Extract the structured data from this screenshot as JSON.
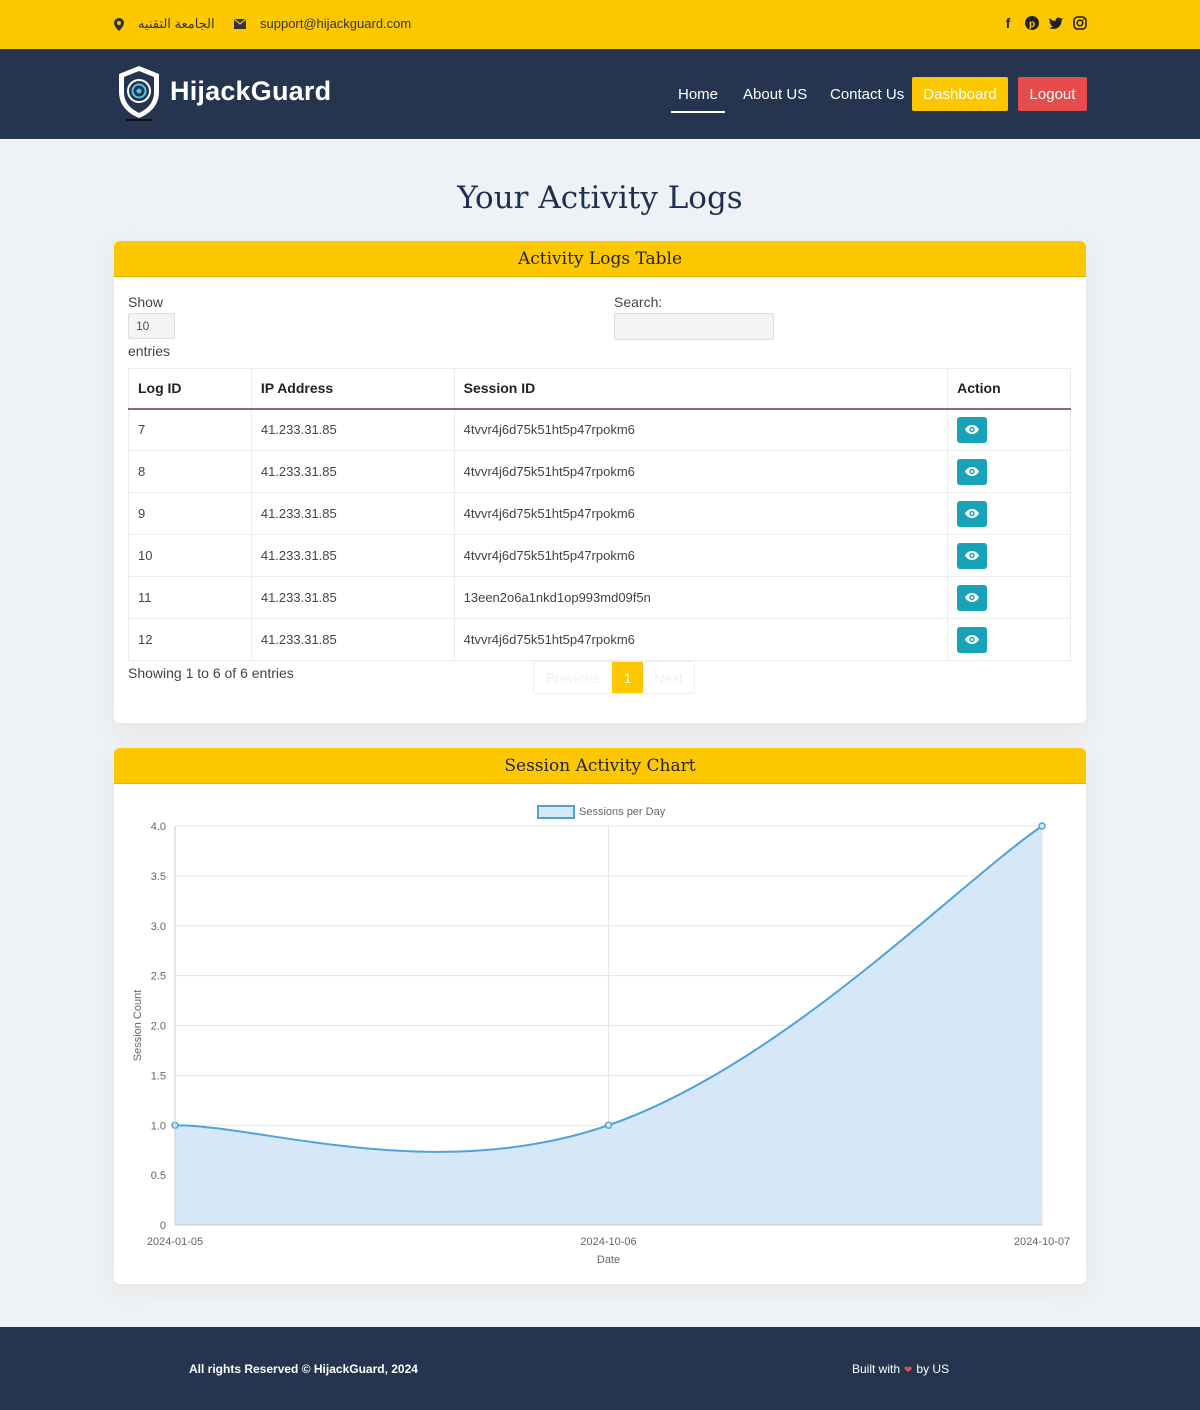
{
  "topbar": {
    "location_text": "الجامعة التقنيه",
    "email": "support@hijackguard.com",
    "icons": [
      "location-pin-icon",
      "envelope-icon",
      "facebook-icon",
      "pinterest-icon",
      "twitter-icon",
      "instagram-icon"
    ]
  },
  "nav": {
    "brand": "HijackGuard",
    "home": "Home",
    "about": "About US",
    "contact": "Contact Us",
    "dashboard": "Dashboard",
    "logout": "Logout"
  },
  "page_title": "Your Activity Logs",
  "logs_card": {
    "header": "Activity Logs Table",
    "show_label": "Show",
    "show_value": "10",
    "entries_label": "entries",
    "search_label": "Search:",
    "columns": [
      "Log ID",
      "IP Address",
      "Session ID",
      "Action"
    ],
    "rows": [
      {
        "id": "7",
        "ip": "41.233.31.85",
        "session": "4tvvr4j6d75k51ht5p47rpokm6"
      },
      {
        "id": "8",
        "ip": "41.233.31.85",
        "session": "4tvvr4j6d75k51ht5p47rpokm6"
      },
      {
        "id": "9",
        "ip": "41.233.31.85",
        "session": "4tvvr4j6d75k51ht5p47rpokm6"
      },
      {
        "id": "10",
        "ip": "41.233.31.85",
        "session": "4tvvr4j6d75k51ht5p47rpokm6"
      },
      {
        "id": "11",
        "ip": "41.233.31.85",
        "session": "13een2o6a1nkd1op993md09f5n"
      },
      {
        "id": "12",
        "ip": "41.233.31.85",
        "session": "4tvvr4j6d75k51ht5p47rpokm6"
      }
    ],
    "showing_text": "Showing 1 to 6 of 6 entries",
    "pager": {
      "previous": "Previous",
      "current": "1",
      "next": "Next"
    }
  },
  "chart_card": {
    "header": "Session Activity Chart"
  },
  "chart_data": {
    "type": "line",
    "categories": [
      "2024-01-05",
      "2024-10-06",
      "2024-10-07"
    ],
    "series": [
      {
        "name": "Sessions per Day",
        "values": [
          1,
          1,
          4
        ]
      }
    ],
    "xlabel": "Date",
    "ylabel": "Session Count",
    "ylim": [
      0,
      4
    ],
    "yticks": [
      "0",
      "0.5",
      "1.0",
      "1.5",
      "2.0",
      "2.5",
      "3.0",
      "3.5",
      "4.0"
    ],
    "legend": "top",
    "grid": true,
    "fill": true,
    "line_color": "#4fa3d9",
    "fill_color": "#d6e8f8"
  },
  "footer": {
    "copyright": "All rights Reserved © HijackGuard, 2024",
    "built_prefix": "Built with",
    "built_suffix": "by US"
  },
  "colors": {
    "accent": "#fdc800",
    "navy": "#253550",
    "danger": "#e74c4c",
    "info": "#17a2b8"
  }
}
